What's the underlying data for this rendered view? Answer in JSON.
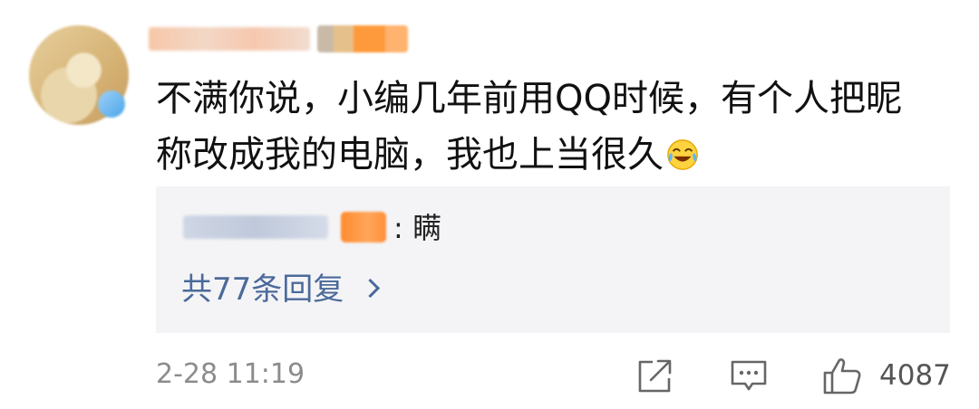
{
  "comment": {
    "text_line1": "不满你说，小编几年前用QQ时候，有个人把昵",
    "text_line2": "称改成我的电脑，我也上当很久",
    "emoji": "laugh-cry-emoji"
  },
  "reply_preview": {
    "text": ": 瞒",
    "more_replies_label": "共77条回复"
  },
  "footer": {
    "timestamp": "2-28 11:19",
    "like_count": "4087"
  },
  "icons": {
    "share": "share-icon",
    "comment": "comment-icon",
    "like": "thumbs-up-icon",
    "chevron": "chevron-right-icon"
  },
  "colors": {
    "link_blue": "#4b6a9a",
    "reply_bg": "#f4f4f6",
    "meta_gray": "#8c8c8c"
  }
}
